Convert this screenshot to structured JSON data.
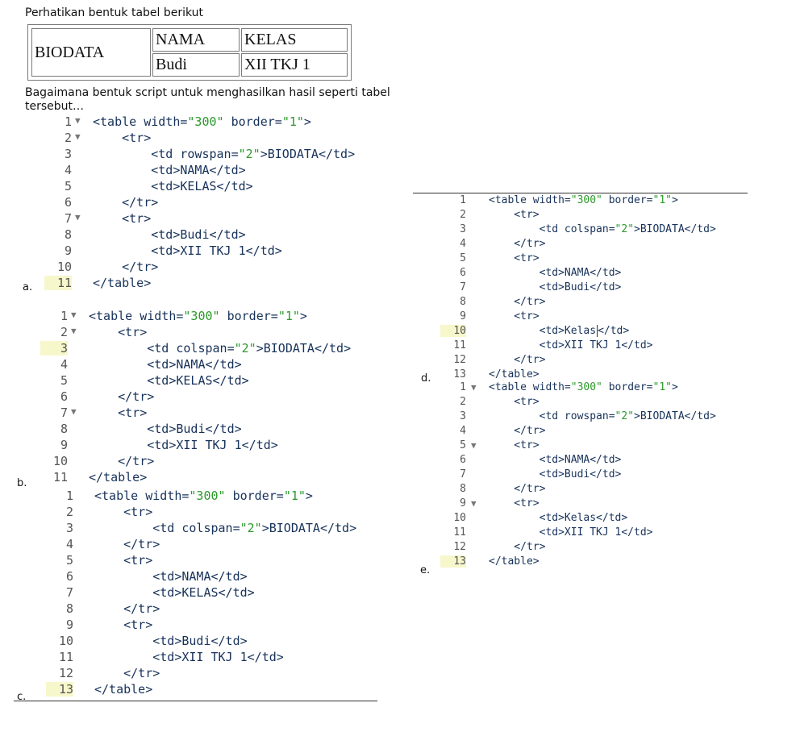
{
  "question": {
    "title": "Perhatikan bentuk tabel berikut",
    "body": "Bagaimana bentuk script untuk menghasilkan hasil seperti tabel tersebut…"
  },
  "sample_table": {
    "biodata": "BIODATA",
    "nama": "NAMA",
    "kelas": "KELAS",
    "budi": "Budi",
    "xii": "XII TKJ 1"
  },
  "options": {
    "a": {
      "label": "a.",
      "lines": [
        {
          "n": "1",
          "text": "<table width=\"300\" border=\"1\">"
        },
        {
          "n": "2",
          "text": "    <tr>"
        },
        {
          "n": "3",
          "text": "        <td rowspan=\"2\">BIODATA</td>"
        },
        {
          "n": "4",
          "text": "        <td>NAMA</td>"
        },
        {
          "n": "5",
          "text": "        <td>KELAS</td>"
        },
        {
          "n": "6",
          "text": "    </tr>"
        },
        {
          "n": "7",
          "text": "    <tr>"
        },
        {
          "n": "8",
          "text": "        <td>Budi</td>"
        },
        {
          "n": "9",
          "text": "        <td>XII TKJ 1</td>"
        },
        {
          "n": "10",
          "text": "    </tr>"
        },
        {
          "n": "11",
          "text": "</table>"
        }
      ]
    },
    "b": {
      "label": "b.",
      "lines": [
        {
          "n": "1",
          "text": "<table width=\"300\" border=\"1\">"
        },
        {
          "n": "2",
          "text": "    <tr>"
        },
        {
          "n": "3",
          "text": "        <td colspan=\"2\">BIODATA</td>"
        },
        {
          "n": "4",
          "text": "        <td>NAMA</td>"
        },
        {
          "n": "5",
          "text": "        <td>KELAS</td>"
        },
        {
          "n": "6",
          "text": "    </tr>"
        },
        {
          "n": "7",
          "text": "    <tr>"
        },
        {
          "n": "8",
          "text": "        <td>Budi</td>"
        },
        {
          "n": "9",
          "text": "        <td>XII TKJ 1</td>"
        },
        {
          "n": "10",
          "text": "    </tr>"
        },
        {
          "n": "11",
          "text": "</table>"
        }
      ]
    },
    "c": {
      "label": "c.",
      "lines": [
        {
          "n": "1",
          "text": "<table width=\"300\" border=\"1\">"
        },
        {
          "n": "2",
          "text": "    <tr>"
        },
        {
          "n": "3",
          "text": "        <td colspan=\"2\">BIODATA</td>"
        },
        {
          "n": "4",
          "text": "    </tr>"
        },
        {
          "n": "5",
          "text": "    <tr>"
        },
        {
          "n": "6",
          "text": "        <td>NAMA</td>"
        },
        {
          "n": "7",
          "text": "        <td>KELAS</td>"
        },
        {
          "n": "8",
          "text": "    </tr>"
        },
        {
          "n": "9",
          "text": "    <tr>"
        },
        {
          "n": "10",
          "text": "        <td>Budi</td>"
        },
        {
          "n": "11",
          "text": "        <td>XII TKJ 1</td>"
        },
        {
          "n": "12",
          "text": "    </tr>"
        },
        {
          "n": "13",
          "text": "</table>"
        }
      ]
    },
    "d": {
      "label": "d.",
      "lines": [
        {
          "n": "1",
          "text": "<table width=\"300\" border=\"1\">"
        },
        {
          "n": "2",
          "text": "    <tr>"
        },
        {
          "n": "3",
          "text": "        <td colspan=\"2\">BIODATA</td>"
        },
        {
          "n": "4",
          "text": "    </tr>"
        },
        {
          "n": "5",
          "text": "    <tr>"
        },
        {
          "n": "6",
          "text": "        <td>NAMA</td>"
        },
        {
          "n": "7",
          "text": "        <td>Budi</td>"
        },
        {
          "n": "8",
          "text": "    </tr>"
        },
        {
          "n": "9",
          "text": "    <tr>"
        },
        {
          "n": "10",
          "text": "        <td>Kelas</td>"
        },
        {
          "n": "11",
          "text": "        <td>XII TKJ 1</td>"
        },
        {
          "n": "12",
          "text": "    </tr>"
        },
        {
          "n": "13",
          "text": "</table>"
        }
      ]
    },
    "e": {
      "label": "e.",
      "lines": [
        {
          "n": "1",
          "text": "<table width=\"300\" border=\"1\">"
        },
        {
          "n": "2",
          "text": "    <tr>"
        },
        {
          "n": "3",
          "text": "        <td rowspan=\"2\">BIODATA</td>"
        },
        {
          "n": "4",
          "text": "    </tr>"
        },
        {
          "n": "5",
          "text": "    <tr>"
        },
        {
          "n": "6",
          "text": "        <td>NAMA</td>"
        },
        {
          "n": "7",
          "text": "        <td>Budi</td>"
        },
        {
          "n": "8",
          "text": "    </tr>"
        },
        {
          "n": "9",
          "text": "    <tr>"
        },
        {
          "n": "10",
          "text": "        <td>Kelas</td>"
        },
        {
          "n": "11",
          "text": "        <td>XII TKJ 1</td>"
        },
        {
          "n": "12",
          "text": "    </tr>"
        },
        {
          "n": "13",
          "text": "</table>"
        }
      ]
    }
  }
}
